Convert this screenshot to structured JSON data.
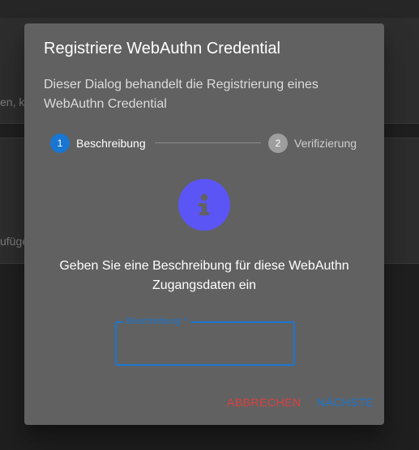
{
  "background": {
    "text_1": "en, kl",
    "text_2": "ufüge"
  },
  "dialog": {
    "title": "Registriere WebAuthn Credential",
    "description": "Dieser Dialog behandelt die Registrierung eines WebAuthn Credential",
    "stepper": {
      "steps": [
        {
          "number": "1",
          "label": "Beschreibung",
          "state": "active"
        },
        {
          "number": "2",
          "label": "Verifizierung",
          "state": "inactive"
        }
      ]
    },
    "icon": "info-icon",
    "prompt": "Geben Sie eine Beschreibung für diese WebAuthn Zugangsdaten ein",
    "field": {
      "label": "Beschreibung *",
      "value": ""
    },
    "actions": {
      "cancel_label": "ABBRECHEN",
      "next_label": "NÄCHSTE"
    }
  },
  "colors": {
    "primary": "#1976d2",
    "danger": "#e04040",
    "icon_bg": "#5b55f5",
    "dialog_bg": "#616161"
  }
}
